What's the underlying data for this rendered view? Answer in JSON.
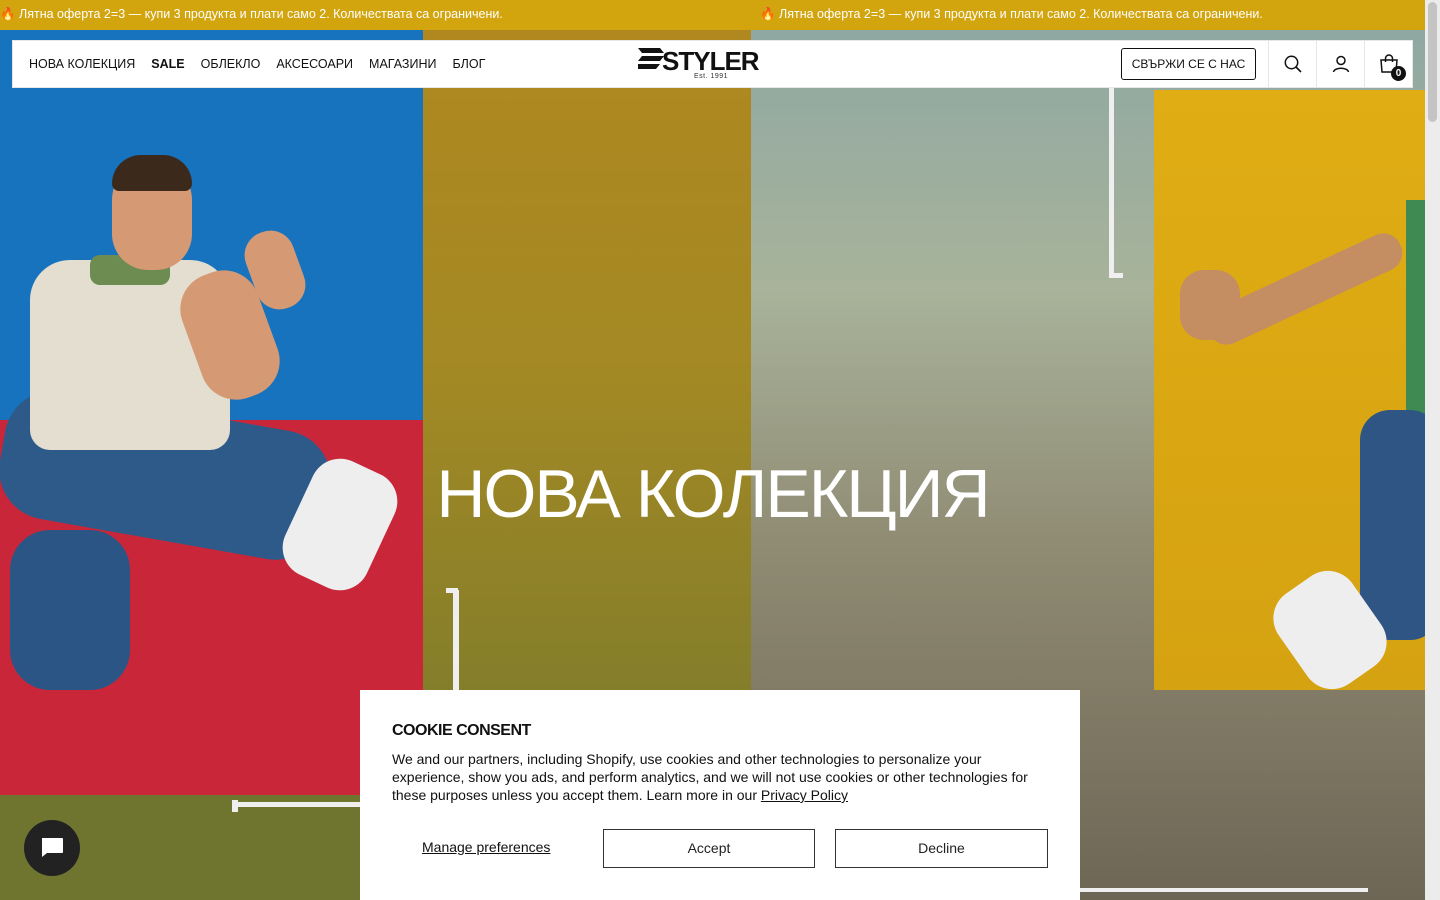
{
  "announcement": {
    "messages": [
      "🔥 Лятна оферта 2=3 — купи 3 продукта и плати само 2. Количествата са ограничени.",
      "🔥 Лятна оферта 2=3 — купи 3 продукта и плати само 2. Количествата са ограничени."
    ]
  },
  "header": {
    "nav": [
      "НОВА КОЛЕКЦИЯ",
      "SALE",
      "ОБЛЕКЛО",
      "АКСЕСОАРИ",
      "МАГАЗИНИ",
      "БЛОГ"
    ],
    "logo": {
      "word": "STYLER",
      "est": "Est. 1991"
    },
    "contact_label": "СВЪРЖИ СЕ С НАС",
    "cart_count": "0",
    "icons": [
      "search-icon",
      "account-icon",
      "cart-icon"
    ]
  },
  "hero": {
    "title": "НОВА КОЛЕКЦИЯ"
  },
  "cookie": {
    "title": "COOKIE CONSENT",
    "text": "We and our partners, including Shopify, use cookies and other technologies to personalize your experience, show you ads, and perform analytics, and we will not use cookies or other technologies for these purposes unless you accept them. Learn more in our",
    "link": "Privacy Policy",
    "manage_label": "Manage preferences",
    "accept_label": "Accept",
    "decline_label": "Decline"
  },
  "chat": {
    "icon": "chat-icon"
  },
  "colors": {
    "announcement_bg": "#d2a50f",
    "text": "#111111"
  }
}
